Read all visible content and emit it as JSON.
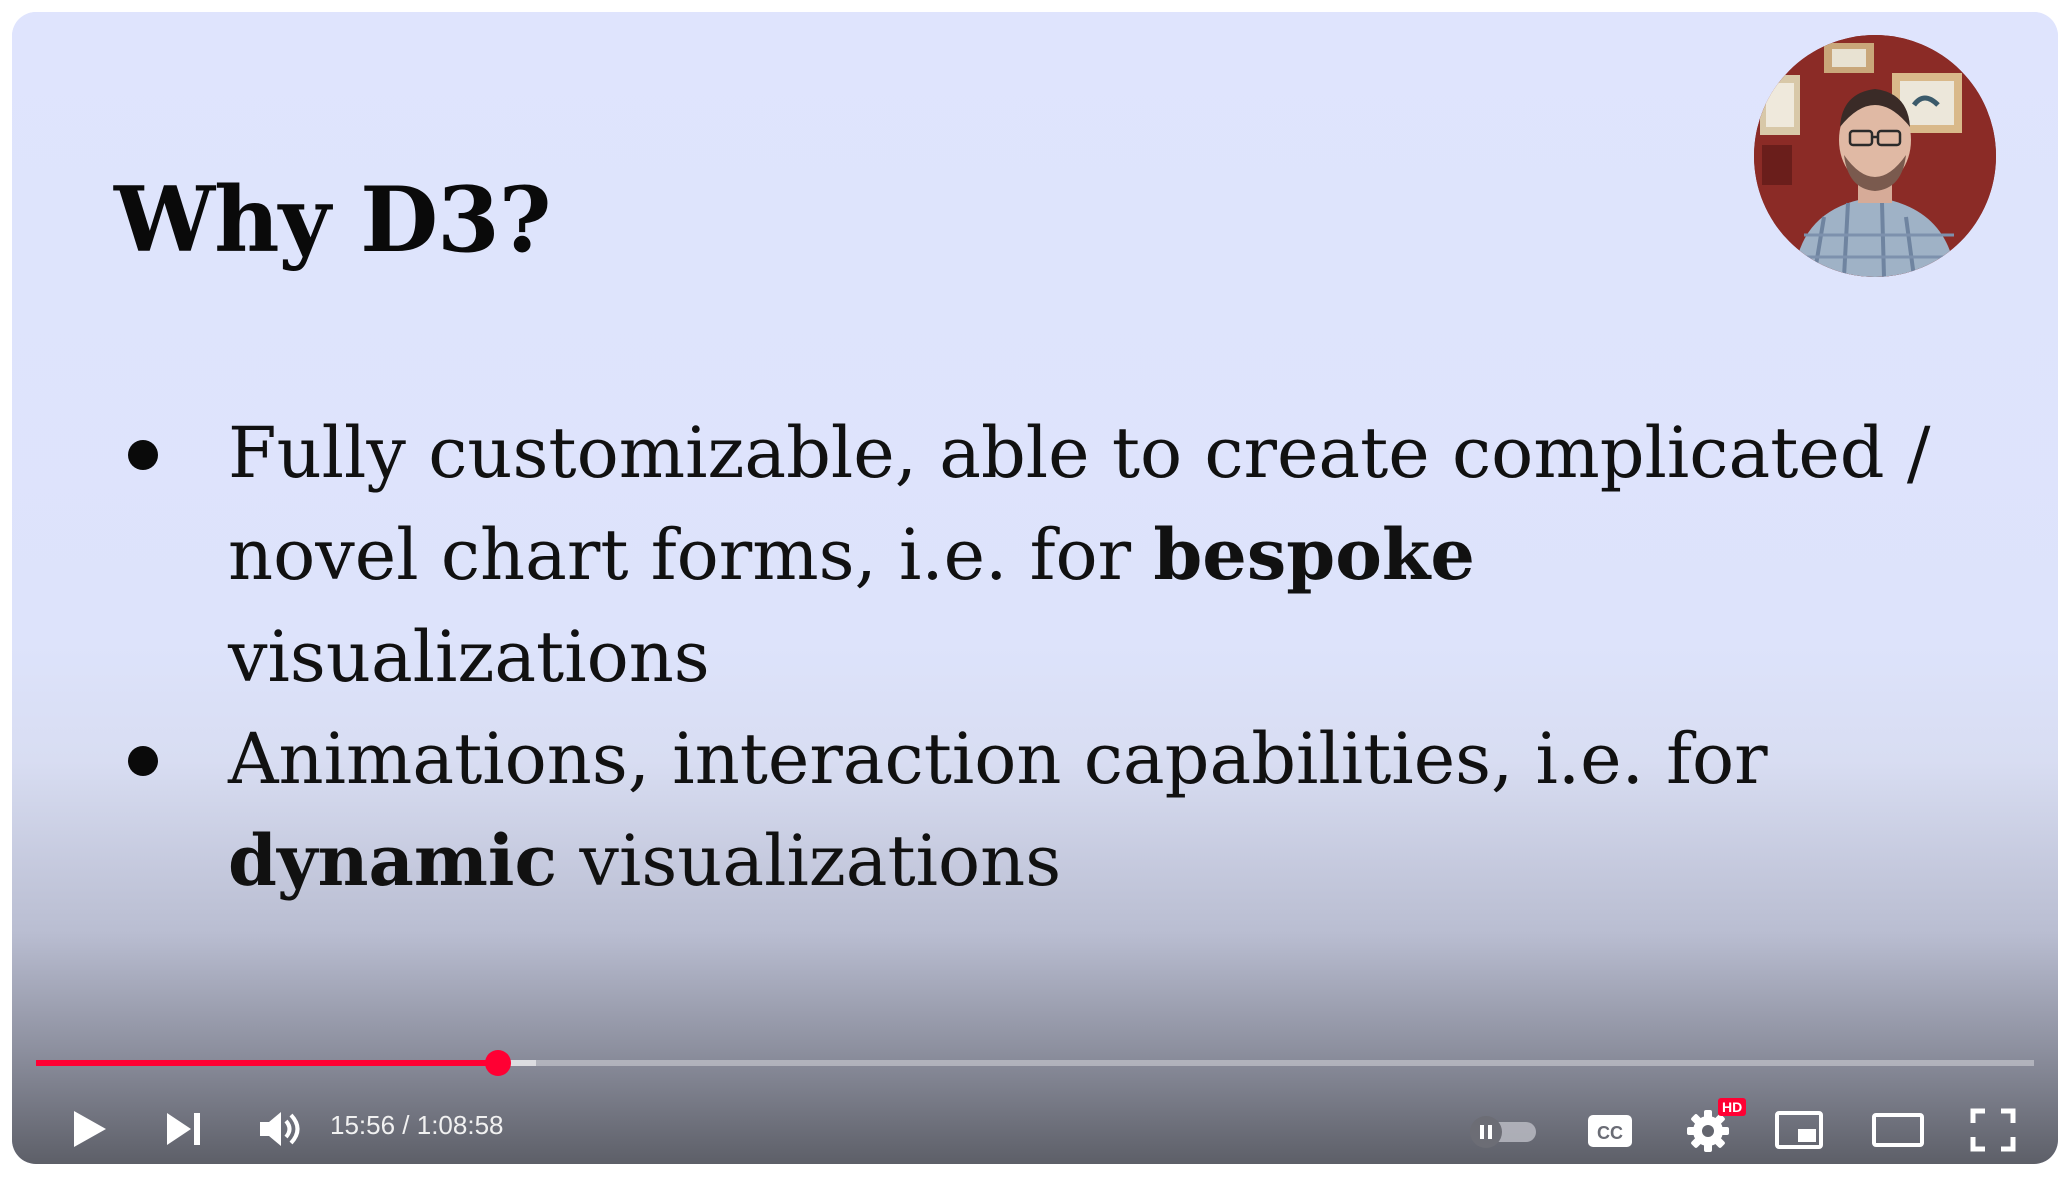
{
  "slide": {
    "title": "Why D3?",
    "bullets": [
      {
        "prefix": "Fully customizable, able to create complicated / novel chart forms, i.e. for ",
        "bold": "bespoke",
        "suffix": " visualizations"
      },
      {
        "prefix": "Animations, interaction capabilities, i.e. for ",
        "bold": "dynamic",
        "suffix": " visualizations"
      }
    ]
  },
  "player": {
    "progress_fraction": 0.231,
    "buffered_fraction": 0.25,
    "time_current": "15:56",
    "time_separator": " / ",
    "time_total": "1:08:58",
    "hd_badge": "HD",
    "accent_color": "#ff0033",
    "icons": {
      "play": "play-icon",
      "next": "next-icon",
      "volume": "volume-icon",
      "autoplay": "autoplay-toggle-icon",
      "captions": "captions-icon",
      "settings": "gear-icon",
      "miniplayer": "miniplayer-icon",
      "theater": "theater-mode-icon",
      "fullscreen": "fullscreen-icon"
    }
  }
}
